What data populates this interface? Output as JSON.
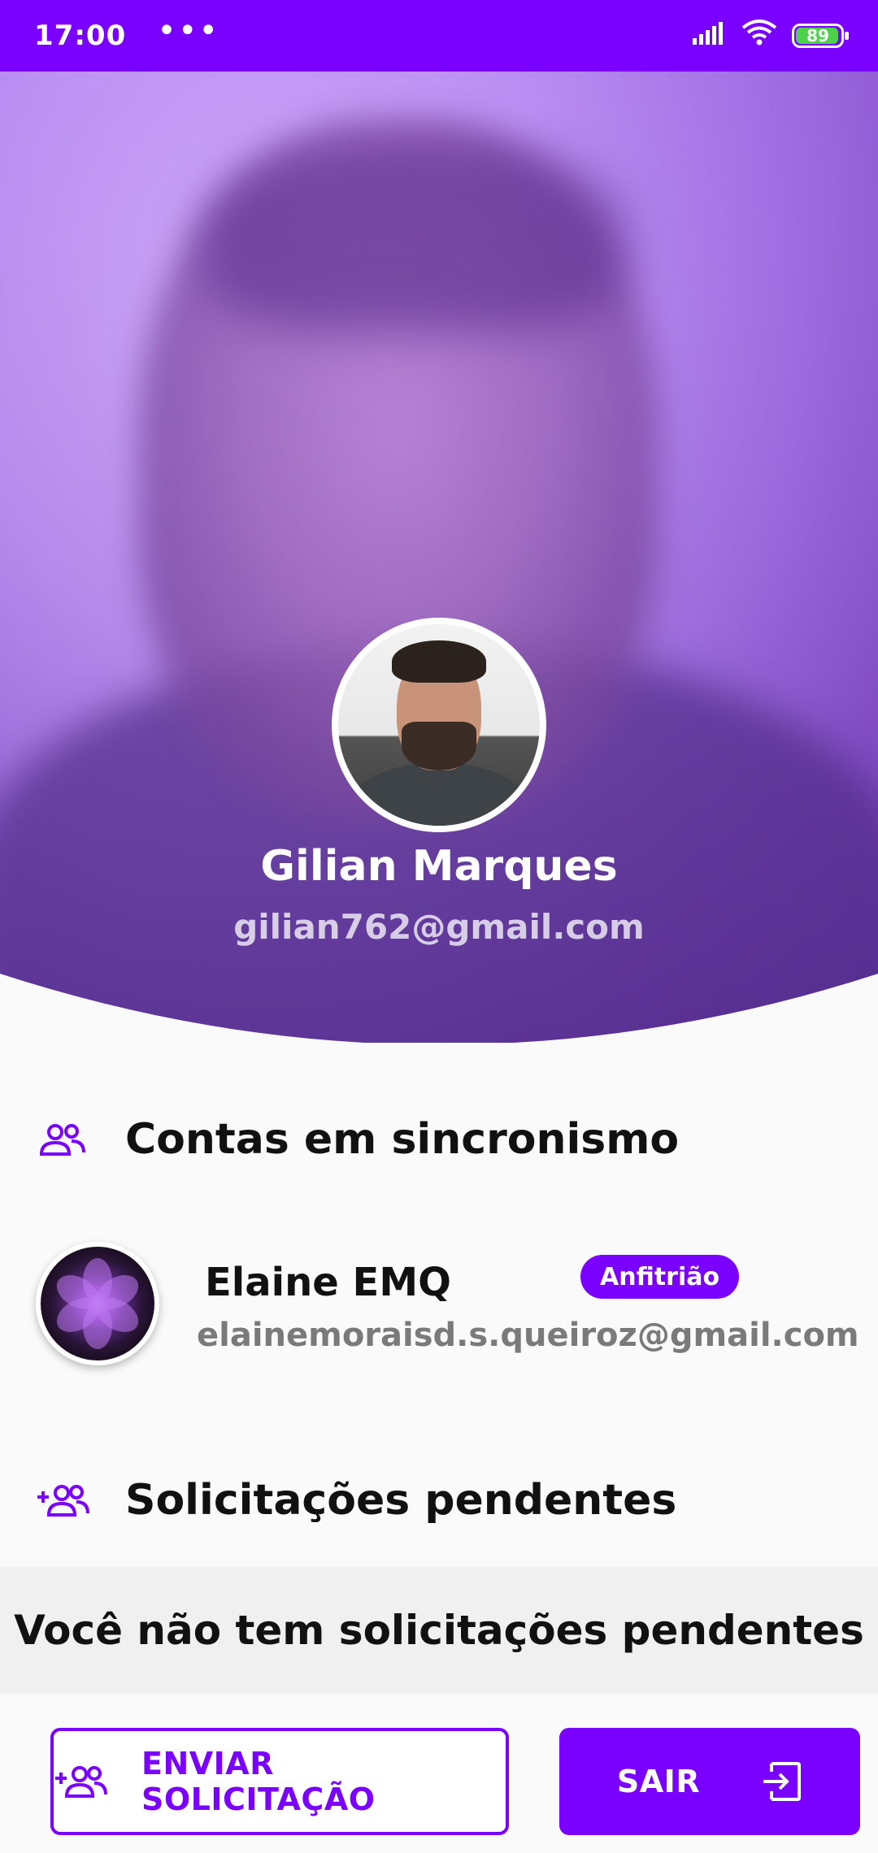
{
  "status_bar": {
    "time": "17:00",
    "more_indicator": "•••",
    "battery_level": "89",
    "icons": [
      "signal-icon",
      "wifi-icon",
      "battery-icon"
    ]
  },
  "profile": {
    "name": "Gilian Marques",
    "email": "gilian762@gmail.com"
  },
  "sync_section": {
    "title": "Contas em sincronismo",
    "icon": "group-icon",
    "accounts": [
      {
        "name": "Elaine EMQ",
        "badge": "Anfitrião",
        "email": "elainemoraisd.s.queiroz@gmail.com"
      }
    ]
  },
  "pending_section": {
    "title": "Solicitações pendentes",
    "icon": "group-add-icon",
    "empty_message": "Você não tem solicitações pendentes"
  },
  "actions": {
    "send_request_label": "ENVIAR SOLICITAÇÃO",
    "send_request_icon": "group-add-icon",
    "exit_label": "SAIR",
    "exit_icon": "exit-icon"
  },
  "colors": {
    "accent": "#7a00ff",
    "background": "#fafafa",
    "muted_text": "#7a7a7a"
  }
}
